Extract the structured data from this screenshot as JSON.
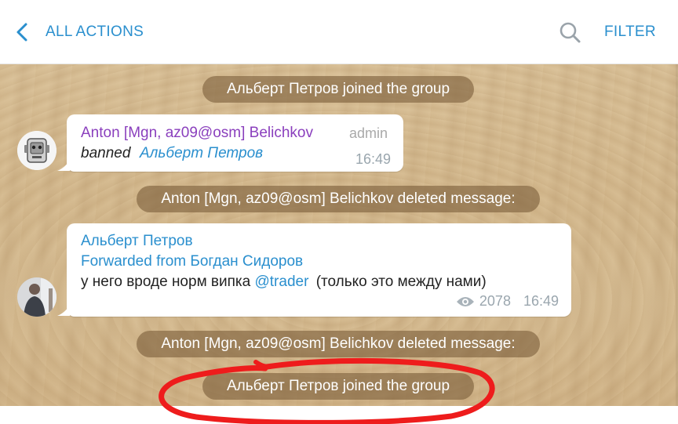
{
  "header": {
    "back_label": "ALL ACTIONS",
    "filter_label": "FILTER",
    "accent_color": "#2a8fce"
  },
  "icons": {
    "back": "chevron-left-icon",
    "search": "search-icon",
    "views": "eye-icon"
  },
  "events": {
    "joined_1": "Альберт Петров joined the group",
    "ban_message": {
      "author": "Anton [Mgn, az09@osm] Belichkov",
      "badge": "admin",
      "action": "banned",
      "target": "Альберт Петров",
      "time": "16:49"
    },
    "deleted_1": "Anton [Mgn, az09@osm] Belichkov deleted message:",
    "deleted_message": {
      "author": "Альберт Петров",
      "forwarded_from": "Forwarded from Богдан Сидоров",
      "text_before": "у него вроде норм випка",
      "mention": "@trader",
      "text_after": "(только это между нами)",
      "views": "2078",
      "time": "16:49"
    },
    "deleted_2": "Anton [Mgn, az09@osm] Belichkov deleted message:",
    "joined_2": "Альберт Петров joined the group"
  },
  "colors": {
    "service_pill": "#7d5f3c",
    "annotation": "#ee1c1c",
    "admin_name": "#8a3fbd"
  }
}
